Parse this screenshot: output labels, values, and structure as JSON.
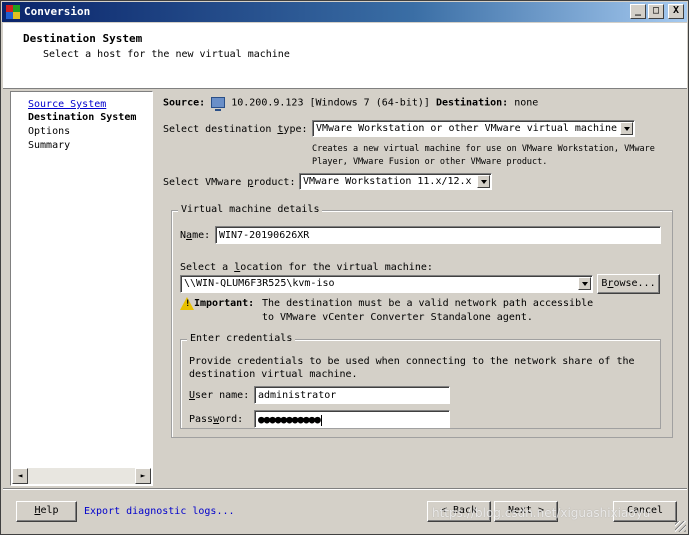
{
  "window": {
    "title": "Conversion",
    "min_label": "_",
    "max_label": "□",
    "close_label": "X"
  },
  "header": {
    "title": "Destination System",
    "subtitle": "Select a host for the new virtual machine"
  },
  "nav": {
    "items": [
      {
        "label": "Source System",
        "state": "link"
      },
      {
        "label": "Destination System",
        "state": "current"
      },
      {
        "label": "Options",
        "state": "normal"
      },
      {
        "label": "Summary",
        "state": "normal"
      }
    ],
    "scroll_left": "◄",
    "scroll_right": "►"
  },
  "summary": {
    "source_label": "Source:",
    "source_value": "10.200.9.123 [Windows 7 (64-bit)]",
    "destination_label": "Destination:",
    "destination_value": "none"
  },
  "dest_type": {
    "label_pre": "Select destination ",
    "label_key": "t",
    "label_post": "ype:",
    "value": "VMware Workstation or other VMware virtual machine",
    "desc_line1": "Creates a new virtual machine for use on VMware Workstation, VMware",
    "desc_line2": "Player, VMware Fusion or other VMware product."
  },
  "product": {
    "label_pre": "Select VMware ",
    "label_key": "p",
    "label_post": "roduct:",
    "value": "VMware Workstation 11.x/12.x"
  },
  "vm_details": {
    "group_title": "Virtual machine details",
    "name_label_pre": "N",
    "name_label_key": "a",
    "name_label_post": "me:",
    "name_value": "WIN7-20190626XR",
    "location_label_pre": "Select a ",
    "location_label_key": "l",
    "location_label_post": "ocation for the virtual machine:",
    "location_value": "\\\\WIN-QLUM6F3R525\\kvm-iso",
    "browse_pre": "B",
    "browse_key": "r",
    "browse_post": "owse...",
    "important_label": "Important:",
    "important_line1": "The destination must be a valid network path accessible",
    "important_line2": "to VMware vCenter Converter Standalone agent."
  },
  "credentials": {
    "group_title": "Enter credentials",
    "desc_line1": "Provide credentials to be used when connecting to the network share of the",
    "desc_line2": "destination virtual machine.",
    "user_label_key": "U",
    "user_label_post": "ser name:",
    "user_value": "administrator",
    "pass_label_pre": "Pass",
    "pass_label_key": "w",
    "pass_label_post": "ord:",
    "pass_value": "●●●●●●●●●●●"
  },
  "footer": {
    "help_key": "H",
    "help_post": "elp",
    "export_link": "Export diagnostic logs...",
    "back_label": "< Back",
    "next_label": "Next >",
    "cancel_label": "Cancel",
    "watermark": "https://blog.csdn.net/xiguashixiaoyu"
  },
  "colors": {
    "dialog_bg": "#d4d0c8",
    "title_gradient_start": "#0a246a",
    "title_gradient_end": "#a6caf0",
    "link": "#0000cc",
    "warning": "#e8c000"
  },
  "icons": {
    "source_machine": "computer-icon",
    "important": "warning-icon",
    "app": "converter-app-icon"
  }
}
